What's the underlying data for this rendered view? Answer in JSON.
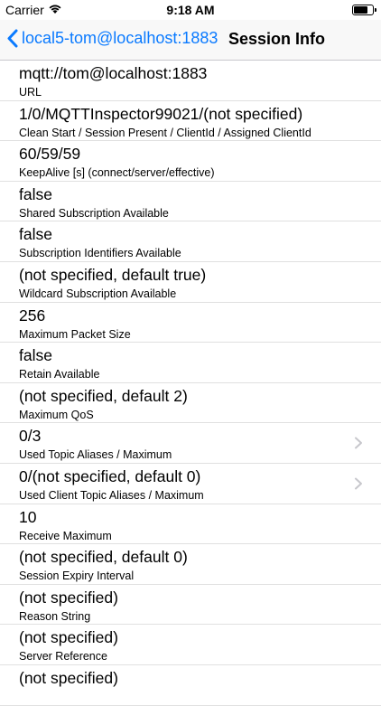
{
  "status": {
    "carrier": "Carrier",
    "time": "9:18 AM",
    "battery_level": 0.8
  },
  "nav": {
    "back_label": "local5-tom@localhost:1883",
    "title": "Session Info"
  },
  "rows": [
    {
      "value": "mqtt://tom@localhost:1883",
      "label": "URL",
      "disclosure": false
    },
    {
      "value": "1/0/MQTTInspector99021/(not specified)",
      "label": "Clean Start / Session Present / ClientId / Assigned ClientId",
      "disclosure": false
    },
    {
      "value": "60/59/59",
      "label": "KeepAlive [s] (connect/server/effective)",
      "disclosure": false
    },
    {
      "value": "false",
      "label": "Shared Subscription Available",
      "disclosure": false
    },
    {
      "value": "false",
      "label": "Subscription Identifiers Available",
      "disclosure": false
    },
    {
      "value": "(not specified, default true)",
      "label": "Wildcard Subscription Available",
      "disclosure": false
    },
    {
      "value": "256",
      "label": "Maximum Packet Size",
      "disclosure": false
    },
    {
      "value": "false",
      "label": "Retain Available",
      "disclosure": false
    },
    {
      "value": "(not specified, default 2)",
      "label": "Maximum QoS",
      "disclosure": false
    },
    {
      "value": "0/3",
      "label": "Used Topic Aliases / Maximum",
      "disclosure": true
    },
    {
      "value": "0/(not specified, default 0)",
      "label": "Used Client Topic Aliases / Maximum",
      "disclosure": true
    },
    {
      "value": "10",
      "label": "Receive Maximum",
      "disclosure": false
    },
    {
      "value": "(not specified, default 0)",
      "label": "Session Expiry Interval",
      "disclosure": false
    },
    {
      "value": "(not specified)",
      "label": "Reason String",
      "disclosure": false
    },
    {
      "value": "(not specified)",
      "label": "Server Reference",
      "disclosure": false
    },
    {
      "value": "(not specified)",
      "label": "",
      "disclosure": false
    }
  ]
}
